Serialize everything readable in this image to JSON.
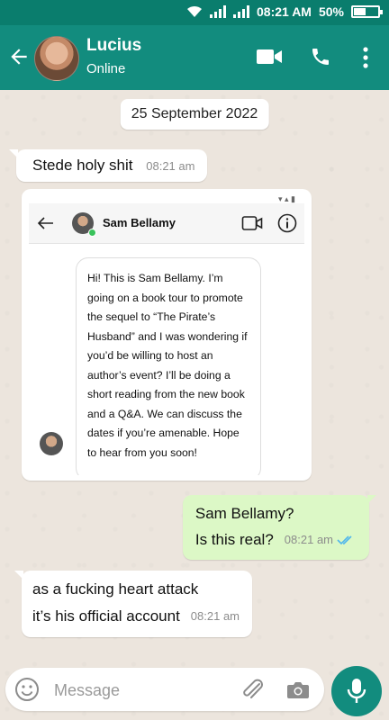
{
  "status_bar": {
    "time": "08:21 AM",
    "battery": "50%"
  },
  "header": {
    "name": "Lucius",
    "status": "Online"
  },
  "chat": {
    "date": "25 September 2022",
    "messages": [
      {
        "text": "Stede holy shit",
        "time": "08:21 am"
      },
      {
        "type": "image"
      },
      {
        "lines": [
          "Sam Bellamy?",
          "Is this real?"
        ],
        "time": "08:21 am"
      },
      {
        "lines": [
          "as a fucking heart attack",
          "it’s his official account"
        ],
        "time": "08:21 am"
      }
    ]
  },
  "screenshot_content": {
    "name": "Sam Bellamy",
    "message_lines": [
      "Hi! This is Sam Bellamy. I’m",
      "going on a book tour to promote",
      "the sequel to “The Pirate’s",
      "Husband” and I was wondering if",
      "you’d be willing to host an",
      "author’s event? I’ll be doing a",
      "short reading from the new book",
      "and a Q&A. We can discuss the",
      "dates if you’re amenable. Hope",
      "to hear from you soon!"
    ]
  },
  "composer": {
    "placeholder": "Message"
  },
  "icons": [
    "back-arrow-icon",
    "video-call-icon",
    "phone-icon",
    "more-icon",
    "emoji-icon",
    "attach-icon",
    "camera-icon",
    "mic-icon",
    "double-check-icon"
  ],
  "colors": {
    "header": "#128c7e",
    "status_bar": "#0a7d6d",
    "outgoing": "#dcf8c6",
    "wallpaper": "#ece5dd",
    "read_ticks": "#4fb6ec"
  }
}
